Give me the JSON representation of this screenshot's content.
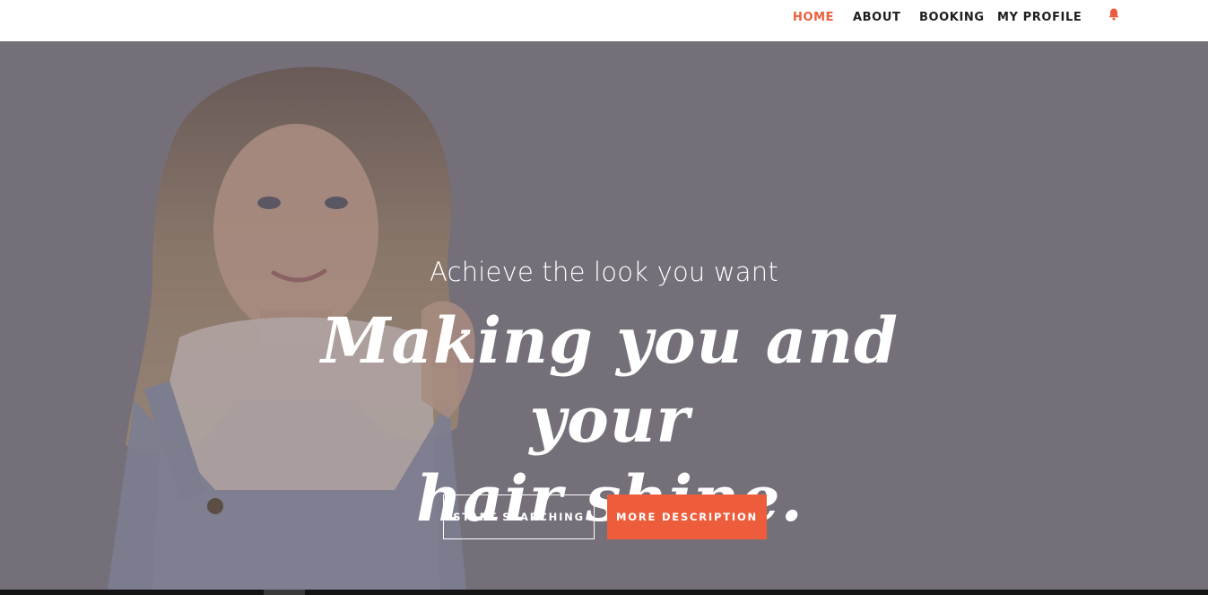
{
  "nav": {
    "items": [
      {
        "label": "HOME",
        "active": true
      },
      {
        "label": "ABOUT",
        "active": false
      },
      {
        "label": "BOOKING",
        "active": false
      },
      {
        "label": "MY PROFILE",
        "active": false
      }
    ],
    "notification_icon": "bell-icon"
  },
  "hero": {
    "subtitle": "Achieve the look you want",
    "title_line1": "Making you and your",
    "title_line2": "hair shine.",
    "primary_button": "START SEARCHING",
    "secondary_button": "MORE DESCRIPTION"
  },
  "colors": {
    "accent": "#ee5d3b",
    "nav_text": "#1e1e1e",
    "hero_overlay": "#7b7780",
    "white": "#ffffff"
  }
}
